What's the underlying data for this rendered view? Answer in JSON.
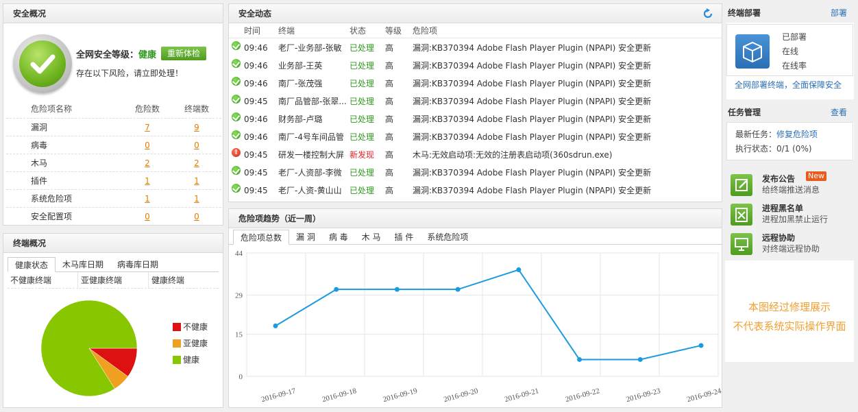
{
  "overview": {
    "title": "安全概况",
    "level_label": "全网安全等级：",
    "level_value": "健康",
    "recheck_label": "重新体检",
    "note": "存在以下风险，请立即处理！",
    "headers": [
      "危险项名称",
      "危险数",
      "终端数"
    ],
    "rows": [
      {
        "name": "漏洞",
        "risk": "7",
        "endpoints": "9"
      },
      {
        "name": "病毒",
        "risk": "0",
        "endpoints": "0"
      },
      {
        "name": "木马",
        "risk": "2",
        "endpoints": "2"
      },
      {
        "name": "插件",
        "risk": "1",
        "endpoints": "1"
      },
      {
        "name": "系统危险项",
        "risk": "1",
        "endpoints": "1"
      },
      {
        "name": "安全配置项",
        "risk": "0",
        "endpoints": "0"
      }
    ]
  },
  "endpoint": {
    "title": "终端概况",
    "tabs": [
      "健康状态",
      "木马库日期",
      "病毒库日期"
    ],
    "subheads": [
      "不健康终端",
      "亚健康终端",
      "健康终端"
    ],
    "pie": [
      {
        "name": "不健康",
        "value": 10,
        "color": "#dd1111"
      },
      {
        "name": "亚健康",
        "value": 6,
        "color": "#f0a020"
      },
      {
        "name": "健康",
        "value": 84,
        "color": "#88c600"
      }
    ]
  },
  "events": {
    "title": "安全动态",
    "headers": [
      "时间",
      "终端",
      "状态",
      "等级",
      "危险项"
    ],
    "rows": [
      {
        "ok": true,
        "time": "09:46",
        "endpoint": "老厂-业务部-张敏",
        "status": "已处理",
        "level": "高",
        "risk": "漏洞:KB370394 Adobe Flash Player Plugin (NPAPI) 安全更新"
      },
      {
        "ok": true,
        "time": "09:46",
        "endpoint": "业务部-王英",
        "status": "已处理",
        "level": "高",
        "risk": "漏洞:KB370394 Adobe Flash Player Plugin (NPAPI) 安全更新"
      },
      {
        "ok": true,
        "time": "09:46",
        "endpoint": "南厂-张茂强",
        "status": "已处理",
        "level": "高",
        "risk": "漏洞:KB370394 Adobe Flash Player Plugin (NPAPI) 安全更新"
      },
      {
        "ok": true,
        "time": "09:45",
        "endpoint": "南厂品管部-张翠...",
        "status": "已处理",
        "level": "高",
        "risk": "漏洞:KB370394 Adobe Flash Player Plugin (NPAPI) 安全更新"
      },
      {
        "ok": true,
        "time": "09:46",
        "endpoint": "财务部-卢璐",
        "status": "已处理",
        "level": "高",
        "risk": "漏洞:KB370394 Adobe Flash Player Plugin (NPAPI) 安全更新"
      },
      {
        "ok": true,
        "time": "09:46",
        "endpoint": "南厂-4号车间品管",
        "status": "已处理",
        "level": "高",
        "risk": "漏洞:KB370394 Adobe Flash Player Plugin (NPAPI) 安全更新"
      },
      {
        "ok": false,
        "time": "09:45",
        "endpoint": "研发一楼控制大屏",
        "status": "新发现",
        "level": "高",
        "risk": "木马:无效启动项:无效的注册表启动项(360sdrun.exe)"
      },
      {
        "ok": true,
        "time": "09:45",
        "endpoint": "老厂-人资部-李微",
        "status": "已处理",
        "level": "高",
        "risk": "漏洞:KB370394 Adobe Flash Player Plugin (NPAPI) 安全更新"
      },
      {
        "ok": true,
        "time": "09:45",
        "endpoint": "老厂-人资-黄山山",
        "status": "已处理",
        "level": "高",
        "risk": "漏洞:KB370394 Adobe Flash Player Plugin (NPAPI) 安全更新"
      }
    ]
  },
  "trend": {
    "title": "危险项趋势（近一周）",
    "tabs": [
      "危险项总数",
      "漏 洞",
      "病 毒",
      "木 马",
      "插 件",
      "系统危险项"
    ]
  },
  "chart_data": {
    "type": "line",
    "x": [
      "2016-09-17",
      "2016-09-18",
      "2016-09-19",
      "2016-09-20",
      "2016-09-21",
      "2016-09-22",
      "2016-09-23",
      "2016-09-24"
    ],
    "values": [
      18,
      31,
      31,
      31,
      38,
      6,
      6,
      11
    ],
    "yticks": [
      "0",
      "15",
      "29",
      "44"
    ],
    "ylim": [
      0,
      44
    ],
    "color": "#1a9ae0"
  },
  "deploy": {
    "title": "终端部署",
    "action": "部署",
    "stats": [
      "已部署",
      "在线",
      "在线率"
    ],
    "link": "全网部署终端，全面保障安全"
  },
  "tasks": {
    "title": "任务管理",
    "action": "查看",
    "latest_label": "最新任务：",
    "latest_value": "修复危险项",
    "status": "执行状态：0/1 (0%)"
  },
  "actions": [
    {
      "title": "发布公告",
      "desc": "给终端推送消息",
      "badge": "New"
    },
    {
      "title": "进程黑名单",
      "desc": "进程加黑禁止运行"
    },
    {
      "title": "远程协助",
      "desc": "对终端远程协助"
    }
  ],
  "watermark": [
    "本图经过修理展示",
    "不代表系统实际操作界面"
  ]
}
